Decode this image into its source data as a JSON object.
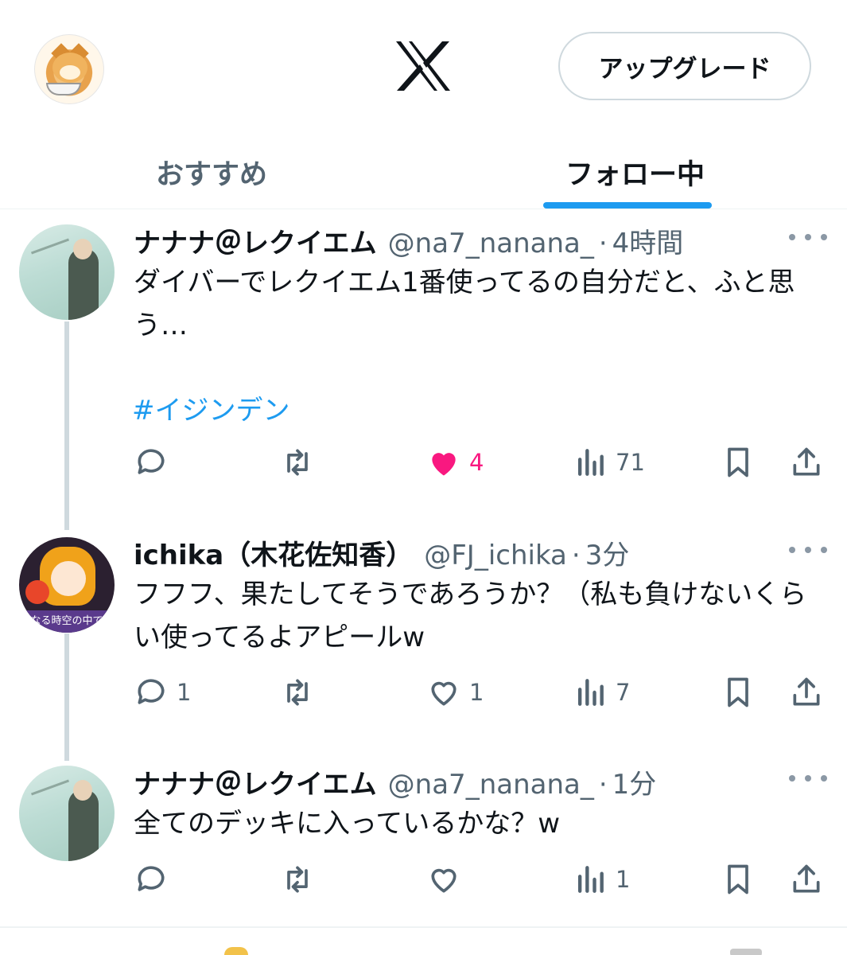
{
  "header": {
    "logo_icon": "x-logo-icon",
    "upgrade_label": "アップグレード"
  },
  "tabs": [
    {
      "label": "おすすめ",
      "active": false
    },
    {
      "label": "フォロー中",
      "active": true
    }
  ],
  "colors": {
    "accent": "#1d9bf0",
    "like": "#f91880",
    "muted": "#536471",
    "thread_line": "#cfd9de"
  },
  "tweets": [
    {
      "display_name": "ナナナ＠レクイエム",
      "handle": "@na7_nanana_",
      "separator": "·",
      "time": "4時間",
      "text": "ダイバーでレクイエム1番使ってるの自分だと、ふと思う…",
      "hashtag": "#イジンデン",
      "replies": "",
      "retweets": "",
      "likes": "4",
      "liked": true,
      "views": "71"
    },
    {
      "display_name": "ichika（木花佐知香）",
      "handle": "@FJ_ichika",
      "separator": "·",
      "time": "3分",
      "text": "フフフ、果たしてそうであろうか？（私も負けないくらい使ってるよアピールw",
      "avatar_banner": "なる時空の中で",
      "replies": "1",
      "retweets": "",
      "likes": "1",
      "liked": false,
      "views": "7"
    },
    {
      "display_name": "ナナナ＠レクイエム",
      "handle": "@na7_nanana_",
      "separator": "·",
      "time": "1分",
      "text": "全てのデッキに入っているかな？w",
      "replies": "",
      "retweets": "",
      "likes": "",
      "liked": false,
      "views": "1"
    }
  ]
}
